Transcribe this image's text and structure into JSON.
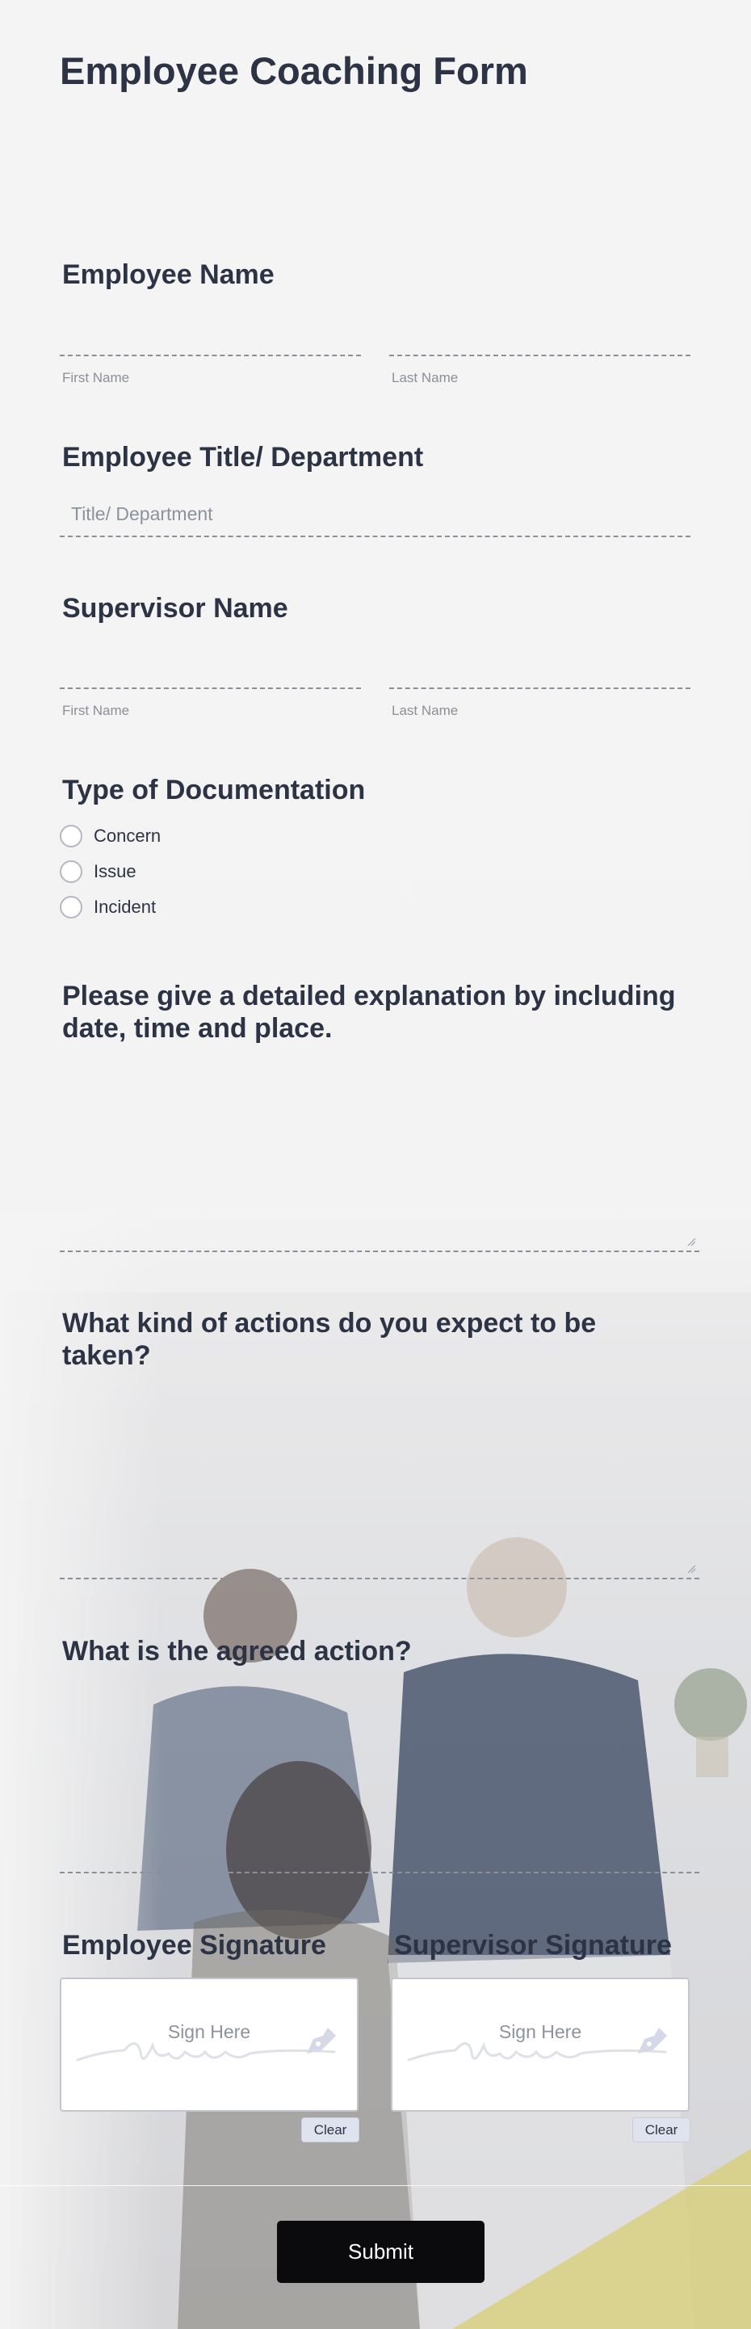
{
  "form": {
    "title": "Employee Coaching Form"
  },
  "employee_name": {
    "label": "Employee Name",
    "first_sublabel": "First Name",
    "last_sublabel": "Last Name"
  },
  "employee_title": {
    "label": "Employee Title/ Department",
    "placeholder": "Title/ Department"
  },
  "supervisor_name": {
    "label": "Supervisor Name",
    "first_sublabel": "First Name",
    "last_sublabel": "Last Name"
  },
  "documentation": {
    "label": "Type of Documentation",
    "options": [
      "Concern",
      "Issue",
      "Incident"
    ]
  },
  "explanation": {
    "label_line1": "Please give a detailed explanation by including",
    "label_line2": "date, time and place."
  },
  "actions_expected": {
    "label_line1": "What kind of actions do you expect to be",
    "label_line2": "taken?"
  },
  "agreed_action": {
    "label": "What is the agreed action?"
  },
  "signatures": {
    "employee_label": "Employee Signature",
    "supervisor_label": "Supervisor Signature",
    "sign_here": "Sign Here",
    "clear_label": "Clear"
  },
  "submit": {
    "label": "Submit"
  },
  "colors": {
    "text": "#2c3345",
    "sublabel": "#8c8f99",
    "submit_bg": "#0b0b0d",
    "clear_bg": "#dfe3ee"
  }
}
